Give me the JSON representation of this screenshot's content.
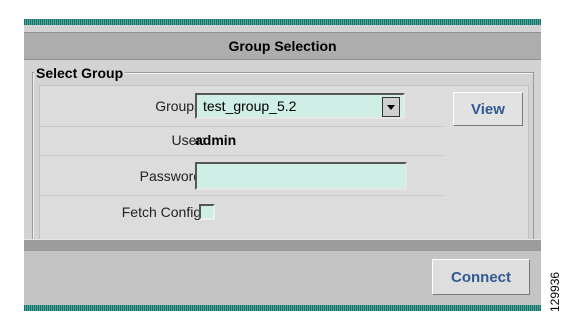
{
  "dialog": {
    "title": "Group Selection",
    "section_label": "Select Group"
  },
  "form": {
    "groups_label": "Groups:",
    "groups_value": "test_group_5.2",
    "view_label": "View",
    "user_label": "User:",
    "user_value": "admin",
    "password_label": "Password:",
    "password_value": "",
    "fetch_config_label": "Fetch Config:",
    "fetch_config_checked": false
  },
  "footer": {
    "connect_label": "Connect"
  },
  "figure_id": "129936",
  "colors": {
    "accent_stripe": "#2f8f85",
    "field_bg": "#cfeee6",
    "button_text": "#315a93"
  }
}
